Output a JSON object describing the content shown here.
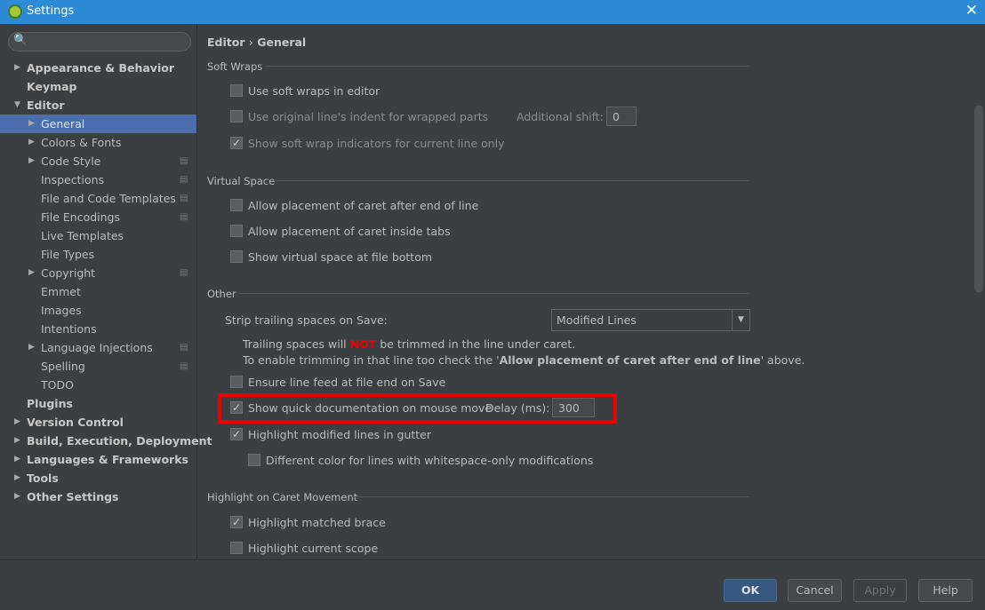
{
  "window": {
    "title": "Settings",
    "close": "✕"
  },
  "search": {
    "icon": "🔍",
    "placeholder": ""
  },
  "tree": [
    {
      "label": "Appearance & Behavior",
      "level": 0,
      "arrow": "▶",
      "bold": true
    },
    {
      "label": "Keymap",
      "level": 0,
      "arrow": "",
      "bold": true
    },
    {
      "label": "Editor",
      "level": 0,
      "arrow": "▼",
      "bold": true
    },
    {
      "label": "General",
      "level": 1,
      "arrow": "▶",
      "selected": true
    },
    {
      "label": "Colors & Fonts",
      "level": 1,
      "arrow": "▶"
    },
    {
      "label": "Code Style",
      "level": 1,
      "arrow": "▶",
      "project": true
    },
    {
      "label": "Inspections",
      "level": 1,
      "arrow": "",
      "project": true
    },
    {
      "label": "File and Code Templates",
      "level": 1,
      "arrow": "",
      "project": true
    },
    {
      "label": "File Encodings",
      "level": 1,
      "arrow": "",
      "project": true
    },
    {
      "label": "Live Templates",
      "level": 1,
      "arrow": ""
    },
    {
      "label": "File Types",
      "level": 1,
      "arrow": ""
    },
    {
      "label": "Copyright",
      "level": 1,
      "arrow": "▶",
      "project": true
    },
    {
      "label": "Emmet",
      "level": 1,
      "arrow": ""
    },
    {
      "label": "Images",
      "level": 1,
      "arrow": ""
    },
    {
      "label": "Intentions",
      "level": 1,
      "arrow": ""
    },
    {
      "label": "Language Injections",
      "level": 1,
      "arrow": "▶",
      "project": true
    },
    {
      "label": "Spelling",
      "level": 1,
      "arrow": "",
      "project": true
    },
    {
      "label": "TODO",
      "level": 1,
      "arrow": ""
    },
    {
      "label": "Plugins",
      "level": 0,
      "arrow": "",
      "bold": true
    },
    {
      "label": "Version Control",
      "level": 0,
      "arrow": "▶",
      "bold": true
    },
    {
      "label": "Build, Execution, Deployment",
      "level": 0,
      "arrow": "▶",
      "bold": true
    },
    {
      "label": "Languages & Frameworks",
      "level": 0,
      "arrow": "▶",
      "bold": true
    },
    {
      "label": "Tools",
      "level": 0,
      "arrow": "▶",
      "bold": true
    },
    {
      "label": "Other Settings",
      "level": 0,
      "arrow": "▶",
      "bold": true
    }
  ],
  "breadcrumb": {
    "parent": "Editor",
    "sep": "›",
    "current": "General"
  },
  "soft_wraps": {
    "title": "Soft Wraps",
    "use_soft_wraps": "Use soft wraps in editor",
    "original_indent": "Use original line's indent for wrapped parts",
    "additional_shift_label": "Additional shift:",
    "additional_shift": "0",
    "show_indicators": "Show soft wrap indicators for current line only"
  },
  "virtual_space": {
    "title": "Virtual Space",
    "after_end": "Allow placement of caret after end of line",
    "inside_tabs": "Allow placement of caret inside tabs",
    "at_bottom": "Show virtual space at file bottom"
  },
  "other": {
    "title": "Other",
    "strip_label": "Strip trailing spaces on Save:",
    "strip_value": "Modified Lines",
    "note1a": "Trailing spaces will ",
    "note1b": "NOT",
    "note1c": " be trimmed in the line under caret.",
    "note2a": "To enable trimming in that line too check the '",
    "note2b": "Allow placement of caret after end of line",
    "note2c": "' above.",
    "line_feed": "Ensure line feed at file end on Save",
    "quick_doc": "Show quick documentation on mouse move",
    "delay_label": "Delay (ms):",
    "delay": "300",
    "highlight_modified": "Highlight modified lines in gutter",
    "diff_color": "Different color for lines with whitespace-only modifications"
  },
  "caret": {
    "title": "Highlight on Caret Movement",
    "matched_brace": "Highlight matched brace",
    "current_scope": "Highlight current scope"
  },
  "checks": {
    "use_soft_wraps": false,
    "original_indent": false,
    "show_indicators": true,
    "after_end": false,
    "inside_tabs": false,
    "at_bottom": false,
    "line_feed": false,
    "quick_doc": true,
    "highlight_modified": true,
    "diff_color": false,
    "matched_brace": true,
    "current_scope": false
  },
  "buttons": {
    "ok": "OK",
    "cancel": "Cancel",
    "apply": "Apply",
    "help": "Help"
  },
  "colors": {
    "titlebar": "#2d8ad6",
    "selection": "#4b6eaf",
    "highlight_box": "#ee0000"
  }
}
